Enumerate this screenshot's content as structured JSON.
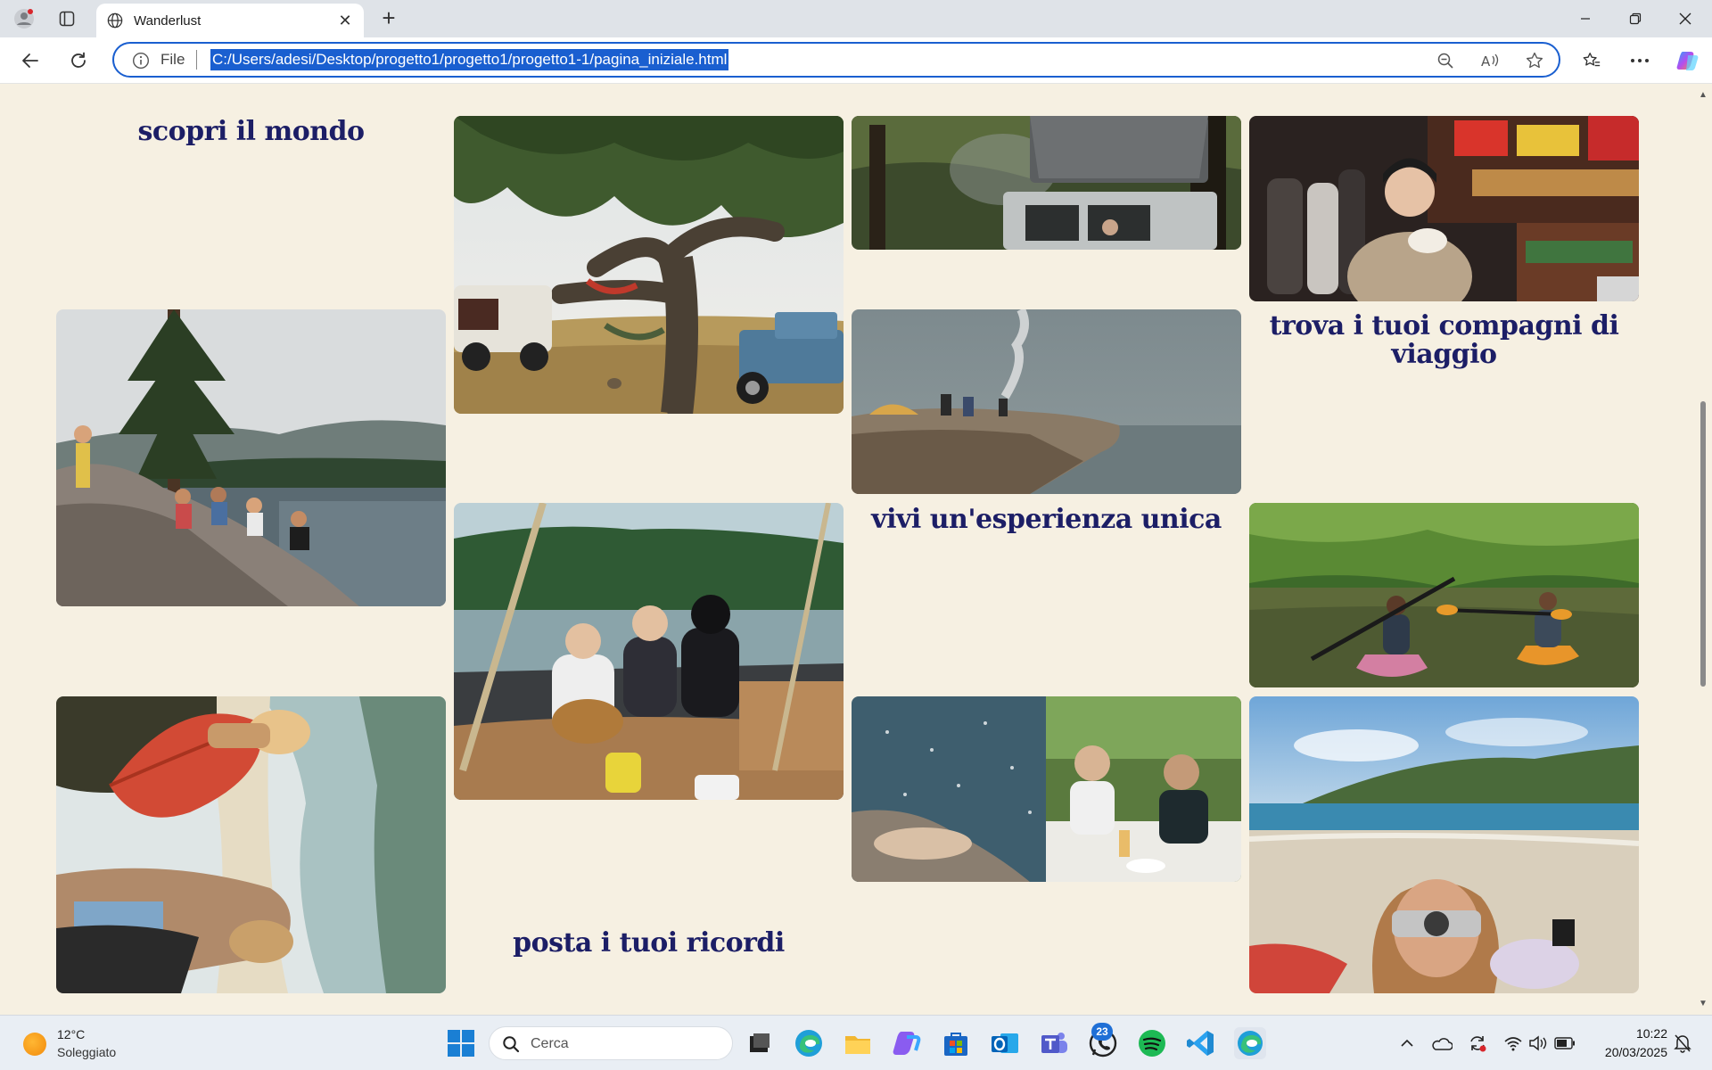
{
  "browser": {
    "tab_title": "Wanderlust",
    "address_prefix": "File",
    "url": "C:/Users/adesi/Desktop/progetto1/progetto1/progetto1-1/pagina_iniziale.html"
  },
  "page": {
    "headings": {
      "discover": "scopri il mondo",
      "companions": "trova i tuoi compagni di viaggio",
      "experience": "vivi un'esperienza unica",
      "memories": "posta i tuoi ricordi"
    },
    "photos": [
      {
        "name": "photo-tree-hammocks",
        "subject": "oak tree with hammocks, pickup trucks and a dog on a hill"
      },
      {
        "name": "photo-rooftop-tent",
        "subject": "car with rooftop tent in a forest, campfire smoke"
      },
      {
        "name": "photo-street-food",
        "subject": "girl eating street food at a night market"
      },
      {
        "name": "photo-lake-friends",
        "subject": "friends sitting on rocks by a mountain lake"
      },
      {
        "name": "photo-cliff-camp",
        "subject": "tent and campers on a rocky cliff with smoke"
      },
      {
        "name": "photo-sailboat-guitar",
        "subject": "friends with a guitar on a sailboat deck"
      },
      {
        "name": "photo-kayaks",
        "subject": "two people paddling kayaks on a green river"
      },
      {
        "name": "photo-surfer-beach",
        "subject": "girls with surfboard on a beach (rotated)"
      },
      {
        "name": "photo-sea-dinner",
        "subject": "sparkling sea with rocks and friends at dinner"
      },
      {
        "name": "photo-beach-camera",
        "subject": "girl taking a photo on a sandy beach"
      }
    ]
  },
  "taskbar": {
    "weather_temp": "12°C",
    "weather_desc": "Soleggiato",
    "search_placeholder": "Cerca",
    "whatsapp_badge": "23",
    "time": "10:22",
    "date": "20/03/2025"
  },
  "colors": {
    "page_bg": "#f6f0e2",
    "heading": "#1c1e66",
    "address_highlight": "#1a5fd0"
  }
}
